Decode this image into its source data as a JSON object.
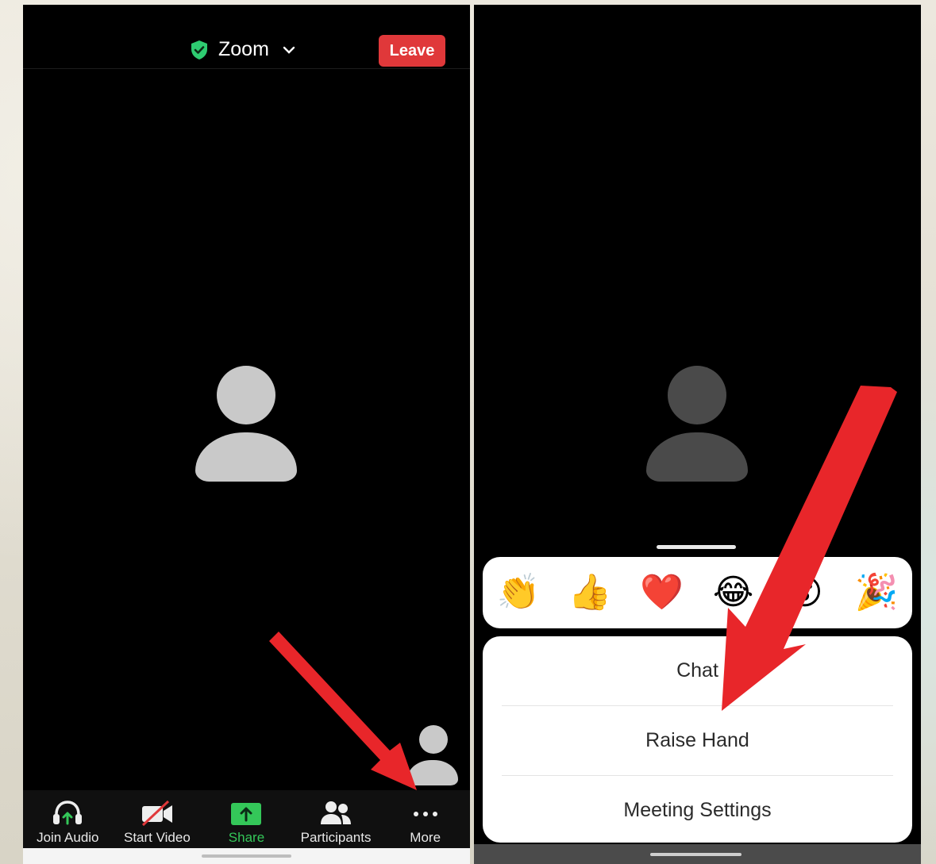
{
  "left_screen": {
    "meeting_title": "Zoom",
    "leave_label": "Leave",
    "toolbar": [
      {
        "label": "Join Audio",
        "icon": "headphones-icon"
      },
      {
        "label": "Start Video",
        "icon": "video-off-icon"
      },
      {
        "label": "Share",
        "icon": "share-screen-icon"
      },
      {
        "label": "Participants",
        "icon": "participants-icon"
      },
      {
        "label": "More",
        "icon": "more-dots-icon"
      }
    ]
  },
  "right_screen": {
    "reactions": [
      {
        "emoji": "👏",
        "name": "clapping-hands"
      },
      {
        "emoji": "👍",
        "name": "thumbs-up"
      },
      {
        "emoji": "❤️",
        "name": "red-heart"
      },
      {
        "emoji": "😂",
        "name": "tears-of-joy"
      },
      {
        "emoji": "😮",
        "name": "surprised-face"
      },
      {
        "emoji": "🎉",
        "name": "party-popper"
      }
    ],
    "menu": [
      {
        "label": "Chat"
      },
      {
        "label": "Raise Hand"
      },
      {
        "label": "Meeting Settings"
      }
    ]
  },
  "colors": {
    "leave_red": "#e0383a",
    "share_green": "#34c759",
    "shield_green": "#2ecc71",
    "annotation_arrow": "#e8262a"
  }
}
